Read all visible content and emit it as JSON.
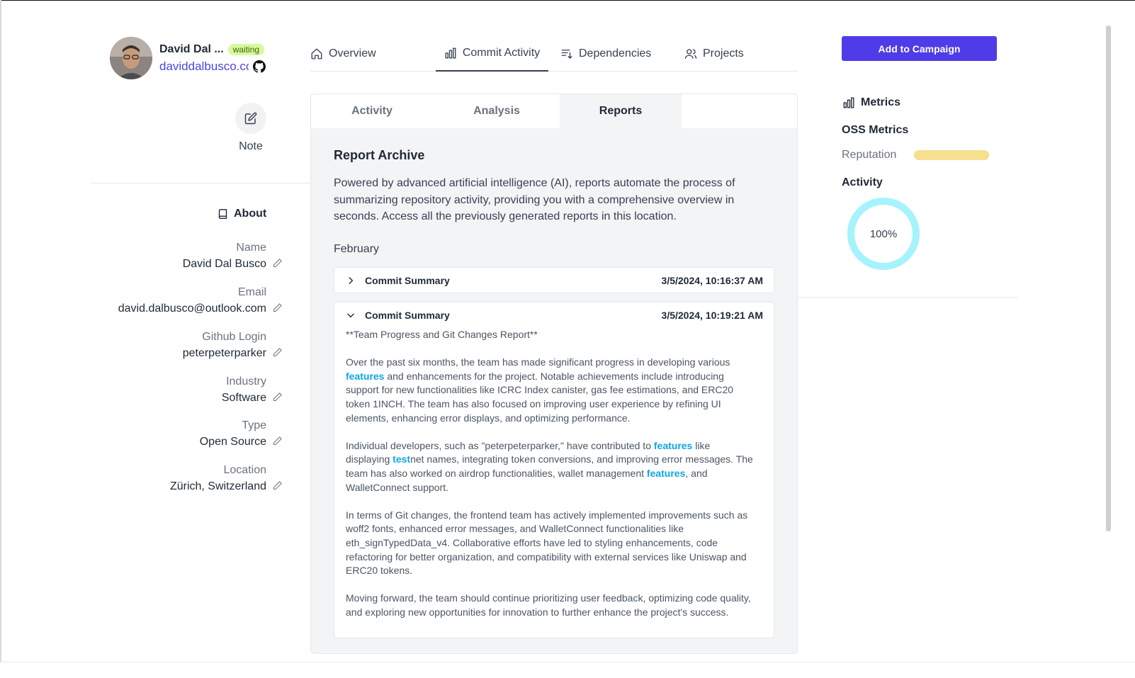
{
  "profile": {
    "name": "David Dal ...",
    "status": "waiting",
    "handle": "daviddalbusco.com"
  },
  "note": {
    "label": "Note"
  },
  "about": {
    "title": "About",
    "fields": [
      {
        "label": "Name",
        "value": "David Dal Busco"
      },
      {
        "label": "Email",
        "value": "david.dalbusco@outlook.com"
      },
      {
        "label": "Github Login",
        "value": "peterpeterparker"
      },
      {
        "label": "Industry",
        "value": "Software"
      },
      {
        "label": "Type",
        "value": "Open Source"
      },
      {
        "label": "Location",
        "value": "Zürich, Switzerland"
      }
    ]
  },
  "nav": {
    "items": [
      {
        "label": "Overview",
        "icon": "home-icon"
      },
      {
        "label": "Commit Activity",
        "icon": "bar-chart-icon"
      },
      {
        "label": "Dependencies",
        "icon": "list-sort-icon"
      },
      {
        "label": "Projects",
        "icon": "users-icon"
      }
    ],
    "active": "Commit Activity"
  },
  "campaign_button": "Add to Campaign",
  "subtabs": {
    "items": [
      "Activity",
      "Analysis",
      "Reports"
    ],
    "active": "Reports"
  },
  "archive": {
    "title": "Report Archive",
    "description": "Powered by advanced artificial intelligence (AI), reports automate the process of summarizing repository activity, providing you with a comprehensive overview in seconds. Access all the previously generated reports in this location.",
    "month": "February",
    "reports": [
      {
        "title": "Commit Summary",
        "date": "3/5/2024, 10:16:37 AM",
        "expanded": false
      },
      {
        "title": "Commit Summary",
        "date": "3/5/2024, 10:19:21 AM",
        "expanded": true,
        "body": {
          "heading": "**Team Progress and Git Changes Report**",
          "p1": {
            "a": "Over the past six months, the team has made significant progress in developing various ",
            "hl1": "features",
            "b": " and enhancements for the project. Notable achievements include introducing support for new functionalities like ICRC Index canister, gas fee estimations, and ERC20 token 1INCH. The team has also focused on improving user experience by refining UI elements, enhancing error displays, and optimizing performance."
          },
          "p2": {
            "a": "Individual developers, such as \"peterpeterparker,\" have contributed to ",
            "hl1": "features",
            "b": " like displaying ",
            "hl2": "test",
            "c": "net names, integrating token conversions, and improving error messages. The team has also worked on airdrop functionalities, wallet management ",
            "hl3": "features",
            "d": ", and WalletConnect support."
          },
          "p3": "In terms of Git changes, the frontend team has actively implemented improvements such as woff2 fonts, enhanced error messages, and WalletConnect functionalities like eth_signTypedData_v4. Collaborative efforts have led to styling enhancements, code refactoring for better organization, and compatibility with external services like Uniswap and ERC20 tokens.",
          "p4": "Moving forward, the team should continue prioritizing user feedback, optimizing code quality, and exploring new opportunities for innovation to further enhance the project's success."
        }
      }
    ]
  },
  "metrics": {
    "title": "Metrics",
    "oss_title": "OSS Metrics",
    "reputation_label": "Reputation",
    "reputation_color": "#f6df8e",
    "activity_title": "Activity",
    "activity_value": "100%",
    "activity_fraction": 1.0,
    "activity_color": "#a5f3fc"
  },
  "colors": {
    "accent": "#4f3ce8",
    "link": "#4f46e5",
    "highlight": "#0ea5e9",
    "badge_bg": "#d9f99d"
  }
}
